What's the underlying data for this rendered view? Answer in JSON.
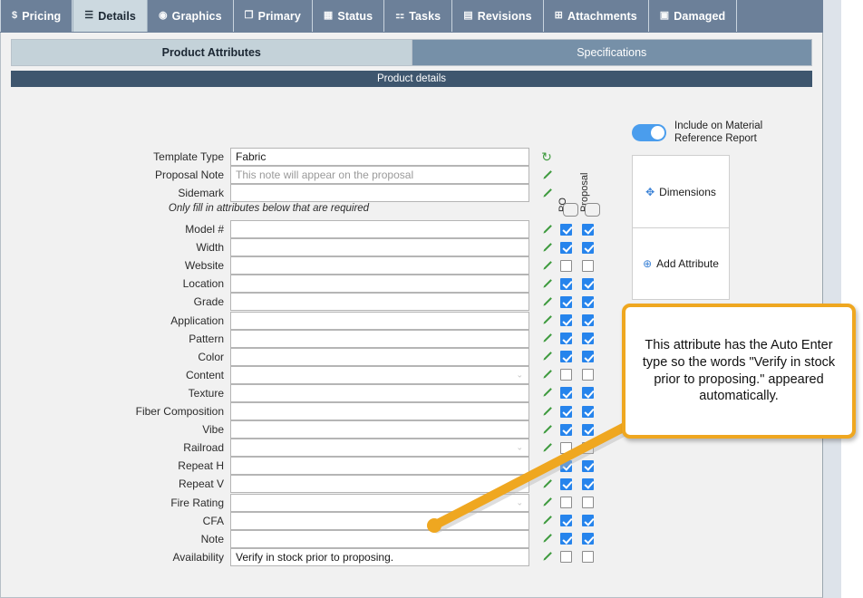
{
  "tabs": [
    {
      "label": "Pricing",
      "icon": "dollar-icon",
      "glyph": "$",
      "active": false
    },
    {
      "label": "Details",
      "icon": "list-icon",
      "glyph": "☰",
      "active": true
    },
    {
      "label": "Graphics",
      "icon": "camera-icon",
      "glyph": "◉",
      "active": false
    },
    {
      "label": "Primary",
      "icon": "copy-icon",
      "glyph": "❐",
      "active": false
    },
    {
      "label": "Status",
      "icon": "calendar-icon",
      "glyph": "▦",
      "active": false
    },
    {
      "label": "Tasks",
      "icon": "people-icon",
      "glyph": "⚏",
      "active": false
    },
    {
      "label": "Revisions",
      "icon": "document-icon",
      "glyph": "▤",
      "active": false
    },
    {
      "label": "Attachments",
      "icon": "attachment-icon",
      "glyph": "⊞",
      "active": false
    },
    {
      "label": "Damaged",
      "icon": "image-icon",
      "glyph": "▣",
      "active": false
    }
  ],
  "subtabs": [
    {
      "label": "Product Attributes",
      "active": true
    },
    {
      "label": "Specifications",
      "active": false
    }
  ],
  "section": {
    "title": "Product details"
  },
  "top_fields": [
    {
      "label": "Template Type",
      "value": "Fabric",
      "placeholder": "",
      "icon": "refresh-icon",
      "icon_glyph": "↻"
    },
    {
      "label": "Proposal Note",
      "value": "",
      "placeholder": "This note will appear on the proposal",
      "icon": "pencil-icon"
    },
    {
      "label": "Sidemark",
      "value": "",
      "placeholder": "",
      "icon": "pencil-icon"
    }
  ],
  "hint": "Only fill in attributes below that are required",
  "columns": {
    "po": "PO",
    "proposal": "Proposal"
  },
  "attributes": [
    {
      "label": "Model #",
      "value": "",
      "dropdown": false,
      "po": true,
      "proposal": true
    },
    {
      "label": "Width",
      "value": "",
      "dropdown": false,
      "po": true,
      "proposal": true
    },
    {
      "label": "Website",
      "value": "",
      "dropdown": false,
      "po": false,
      "proposal": false
    },
    {
      "label": "Location",
      "value": "",
      "dropdown": false,
      "po": true,
      "proposal": true
    },
    {
      "label": "Grade",
      "value": "",
      "dropdown": false,
      "po": true,
      "proposal": true
    },
    {
      "label": "Application",
      "value": "",
      "dropdown": false,
      "po": true,
      "proposal": true
    },
    {
      "label": "Pattern",
      "value": "",
      "dropdown": false,
      "po": true,
      "proposal": true
    },
    {
      "label": "Color",
      "value": "",
      "dropdown": false,
      "po": true,
      "proposal": true
    },
    {
      "label": "Content",
      "value": "",
      "dropdown": true,
      "po": false,
      "proposal": false
    },
    {
      "label": "Texture",
      "value": "",
      "dropdown": false,
      "po": true,
      "proposal": true
    },
    {
      "label": "Fiber Composition",
      "value": "",
      "dropdown": false,
      "po": true,
      "proposal": true
    },
    {
      "label": "Vibe",
      "value": "",
      "dropdown": false,
      "po": true,
      "proposal": true
    },
    {
      "label": "Railroad",
      "value": "",
      "dropdown": true,
      "po": false,
      "proposal": false
    },
    {
      "label": "Repeat H",
      "value": "",
      "dropdown": false,
      "po": true,
      "proposal": true
    },
    {
      "label": "Repeat V",
      "value": "",
      "dropdown": false,
      "po": true,
      "proposal": true
    },
    {
      "label": "Fire Rating",
      "value": "",
      "dropdown": true,
      "po": false,
      "proposal": false
    },
    {
      "label": "CFA",
      "value": "",
      "dropdown": false,
      "po": true,
      "proposal": true
    },
    {
      "label": "Note",
      "value": "",
      "dropdown": false,
      "po": true,
      "proposal": true
    },
    {
      "label": "Availability",
      "value": "Verify in stock prior to proposing.",
      "dropdown": false,
      "po": false,
      "proposal": false
    }
  ],
  "side": {
    "toggle_label": "Include on Material Reference Report",
    "toggle_on": true,
    "buttons": [
      {
        "label": "Dimensions",
        "icon": "move-icon",
        "glyph": "✥"
      },
      {
        "label": "Add Attribute",
        "icon": "plus-circle-icon",
        "glyph": "⊕"
      }
    ]
  },
  "callout": {
    "text": "This attribute has the Auto Enter type so the words \"Verify in stock prior to proposing.\" appeared automatically.",
    "color": "#efa720"
  }
}
